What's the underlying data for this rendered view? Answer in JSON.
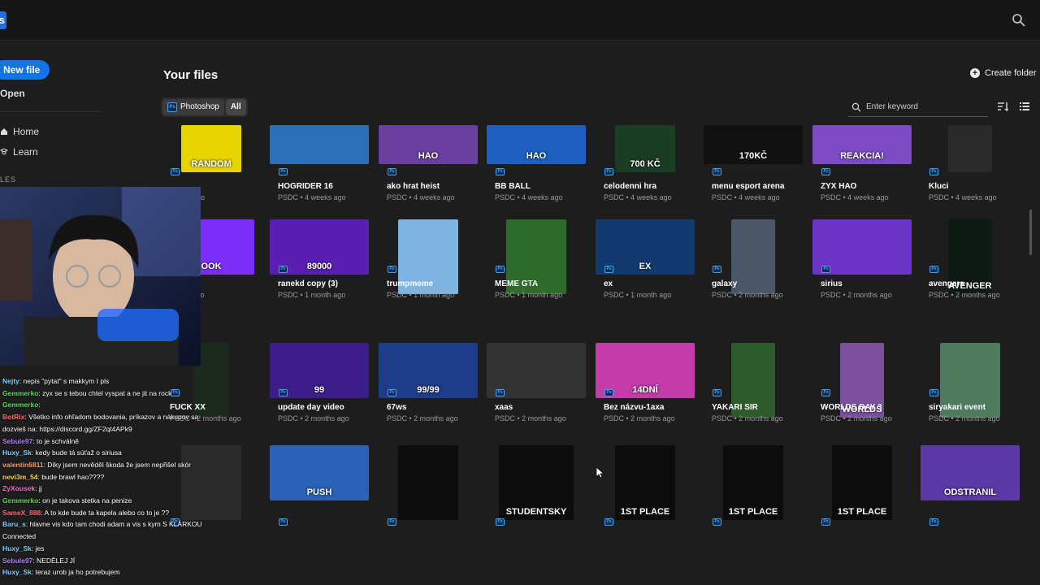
{
  "app": {
    "logo_letter": "s"
  },
  "colors": {
    "accent": "#1473e6",
    "ps_blue": "#31a8ff"
  },
  "sidebar": {
    "new_file": "New file",
    "open": "Open",
    "home": "Home",
    "learn": "Learn",
    "files_label": "LES"
  },
  "main": {
    "title": "Your files",
    "create_folder": "Create folder",
    "filter_photoshop": "Photoshop",
    "filter_all": "All",
    "search_placeholder": "Enter keyword"
  },
  "files": [
    {
      "name": "",
      "meta": "weeks ago",
      "thumb": "#e7d400",
      "thumb_text": "RANDOM"
    },
    {
      "name": "HOGRIDER 16",
      "meta": "PSDC • 4 weeks ago",
      "thumb": "#2c6fb7",
      "thumb_text": ""
    },
    {
      "name": "ako hrat heist",
      "meta": "PSDC • 4 weeks ago",
      "thumb": "#6b3fa0",
      "thumb_text": "HAO"
    },
    {
      "name": "BB BALL",
      "meta": "PSDC • 4 weeks ago",
      "thumb": "#1e5fbf",
      "thumb_text": "HAO"
    },
    {
      "name": "celodenni hra",
      "meta": "PSDC • 4 weeks ago",
      "thumb": "#1a3d23",
      "thumb_text": "700 KČ"
    },
    {
      "name": "menu esport arena",
      "meta": "PSDC • 4 weeks ago",
      "thumb": "#111111",
      "thumb_text": "170KČ"
    },
    {
      "name": "ZYX HAO",
      "meta": "PSDC • 4 weeks ago",
      "thumb": "#7d4bc4",
      "thumb_text": "REAKCIA!"
    },
    {
      "name": "Kluci",
      "meta": "PSDC • 4 weeks ago",
      "thumb": "#2a2a2a",
      "thumb_text": ""
    },
    {
      "name": "",
      "meta": "month ago",
      "thumb": "#7b2ff7",
      "thumb_text": "OOK"
    },
    {
      "name": "ranekd copy (3)",
      "meta": "PSDC • 1 month ago",
      "thumb": "#5a1fb0",
      "thumb_text": "89000"
    },
    {
      "name": "trumpmeme",
      "meta": "PSDC • 1 month ago",
      "thumb": "#7fb3e0",
      "thumb_text": ""
    },
    {
      "name": "MEME GTA",
      "meta": "PSDC • 1 month ago",
      "thumb": "#2f6b2a",
      "thumb_text": ""
    },
    {
      "name": "ex",
      "meta": "PSDC • 1 month ago",
      "thumb": "#123a6e",
      "thumb_text": "EX"
    },
    {
      "name": "galaxy",
      "meta": "PSDC • 2 months ago",
      "thumb": "#4a5566",
      "thumb_text": ""
    },
    {
      "name": "sirius",
      "meta": "PSDC • 2 months ago",
      "thumb": "#6b34c6",
      "thumb_text": ""
    },
    {
      "name": "avengers",
      "meta": "PSDC • 2 months ago",
      "thumb": "#0f1a12",
      "thumb_text": "AVENGERS"
    },
    {
      "name": "FUCK XX",
      "meta": "PSDC • 2 months ago",
      "thumb": "#1b2a1d",
      "thumb_text": ""
    },
    {
      "name": "update day video",
      "meta": "PSDC • 2 months ago",
      "thumb": "#3d1d8a",
      "thumb_text": "99"
    },
    {
      "name": "67ws",
      "meta": "PSDC • 2 months ago",
      "thumb": "#1d3c8a",
      "thumb_text": "99/99"
    },
    {
      "name": "xaas",
      "meta": "PSDC • 2 months ago",
      "thumb": "#333333",
      "thumb_text": ""
    },
    {
      "name": "Bez názvu-1axa",
      "meta": "PSDC • 2 months ago",
      "thumb": "#c33ca8",
      "thumb_text": "14DNÍ"
    },
    {
      "name": "YAKARI SIR",
      "meta": "PSDC • 2 months ago",
      "thumb": "#2d5a2b",
      "thumb_text": ""
    },
    {
      "name": "WORLDS DAY 3",
      "meta": "PSDC • 2 months ago",
      "thumb": "#7a4f9e",
      "thumb_text": "WORLDS"
    },
    {
      "name": "siryakari event",
      "meta": "PSDC • 2 months ago",
      "thumb": "#4d7a5d",
      "thumb_text": ""
    },
    {
      "name": "",
      "meta": "",
      "thumb": "#2a2a2a",
      "thumb_text": ""
    },
    {
      "name": "",
      "meta": "",
      "thumb": "#2b62b8",
      "thumb_text": "PUSH"
    },
    {
      "name": "",
      "meta": "",
      "thumb": "#0c0c0c",
      "thumb_text": ""
    },
    {
      "name": "",
      "meta": "",
      "thumb": "#0c0c0c",
      "thumb_text": "STUDENTSKY"
    },
    {
      "name": "",
      "meta": "",
      "thumb": "#0c0c0c",
      "thumb_text": "1ST PLACE"
    },
    {
      "name": "",
      "meta": "",
      "thumb": "#0c0c0c",
      "thumb_text": "1ST PLACE"
    },
    {
      "name": "",
      "meta": "",
      "thumb": "#0c0c0c",
      "thumb_text": "1ST PLACE"
    },
    {
      "name": "",
      "meta": "",
      "thumb": "#5b3aa8",
      "thumb_text": "ODSTRANIL"
    }
  ],
  "chat": [
    {
      "user": "Nejty",
      "color": "#7fd0ff",
      "text": ": nepis \"pytat\" s makkym I pls"
    },
    {
      "user": "Gemmerko",
      "color": "#5cd65c",
      "text": ": zyx se s tebou chtel vyspat a ne jit na rock"
    },
    {
      "user": "Gemmerko",
      "color": "#5cd65c",
      "text": ":"
    },
    {
      "user": "BotRix",
      "color": "#ff6b6b",
      "text": ": Všetko info ohľadom bodovania, príkazov a nákupov sa"
    },
    {
      "user": "",
      "color": "#ffffff",
      "text": "dozvieš na: https://discord.gg/ZF2qt4APk9"
    },
    {
      "user": "Sebule97",
      "color": "#b57cff",
      "text": ": to je schválně"
    },
    {
      "user": "Huxy_Sk",
      "color": "#7fd0ff",
      "text": ": kedy bude tá súťaž o siriusa"
    },
    {
      "user": "valentin6811",
      "color": "#ff9f5a",
      "text": ": Díky jsem nevěděl škoda že jsem nepřišel skór"
    },
    {
      "user": "nevi3m_54",
      "color": "#ffd34d",
      "text": ": bude brawl hao????"
    },
    {
      "user": "ZyXousek",
      "color": "#ff6bd6",
      "text": ": jj"
    },
    {
      "user": "Gemmerko",
      "color": "#5cd65c",
      "text": ": on je takova stetka na penize"
    },
    {
      "user": "SameX_888",
      "color": "#ff6b6b",
      "text": ": A to kde bude ta kapela alebo co to je ??"
    },
    {
      "user": "Baru_s",
      "color": "#7fd0ff",
      "text": ": hlavne vis kdo tam chodi adam a vis s kym S KLÁRKOU"
    },
    {
      "user": "",
      "color": "#ffffff",
      "text": "Connected"
    },
    {
      "user": "Huxy_Sk",
      "color": "#7fd0ff",
      "text": ": jes"
    },
    {
      "user": "Sebule97",
      "color": "#b57cff",
      "text": ": NEDĚLEJ JÍ"
    },
    {
      "user": "Huxy_Sk",
      "color": "#7fd0ff",
      "text": ": teraz urob ja ho potrebujem"
    }
  ]
}
